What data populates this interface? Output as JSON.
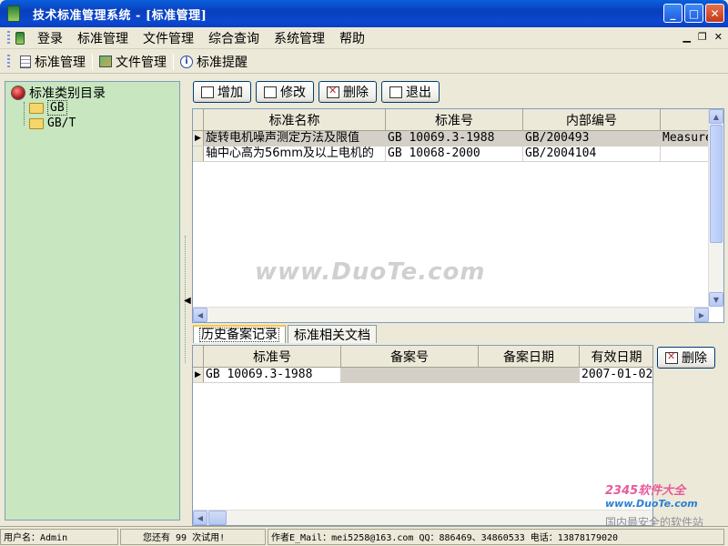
{
  "window": {
    "title": "技术标准管理系统 - [标准管理]"
  },
  "menubar": {
    "items": [
      "登录",
      "标准管理",
      "文件管理",
      "综合查询",
      "系统管理",
      "帮助"
    ]
  },
  "toolbar": {
    "items": [
      {
        "label": "标准管理",
        "icon": "document-icon"
      },
      {
        "label": "文件管理",
        "icon": "files-icon"
      },
      {
        "label": "标准提醒",
        "icon": "info-icon"
      }
    ]
  },
  "tree": {
    "root": "标准类别目录",
    "children": [
      "GB",
      "GB/T"
    ],
    "selected": "GB"
  },
  "actions": {
    "add": "增加",
    "edit": "修改",
    "delete": "删除",
    "exit": "退出"
  },
  "standards_grid": {
    "columns": [
      "标准名称",
      "标准号",
      "内部编号",
      ""
    ],
    "rows": [
      [
        "旋转电机噪声测定方法及限值",
        "GB 10069.3-1988",
        "GB/200493",
        "Measure"
      ],
      [
        "轴中心高为56mm及以上电机的",
        "GB 10068-2000",
        "GB/2004104",
        ""
      ]
    ]
  },
  "tabs": {
    "items": [
      "历史备案记录",
      "标准相关文档"
    ],
    "active": 0
  },
  "history_grid": {
    "columns": [
      "标准号",
      "备案号",
      "备案日期",
      "有效日期"
    ],
    "rows": [
      [
        "GB 10069.3-1988",
        "",
        "",
        "2007-01-02"
      ]
    ],
    "delete_label": "删除"
  },
  "watermark": {
    "text": "www.DuoTe.com",
    "corner_brand": "2345软件大全",
    "corner_url": "www.DuoTe.com",
    "corner_sub": "国内最安全的软件站"
  },
  "statusbar": {
    "user": "用户名：Admin",
    "trial": "您还有 99 次试用!",
    "author": "作者E_Mail：mei5258@163.com  QQ：886469、34860533  电话：13878179020"
  }
}
